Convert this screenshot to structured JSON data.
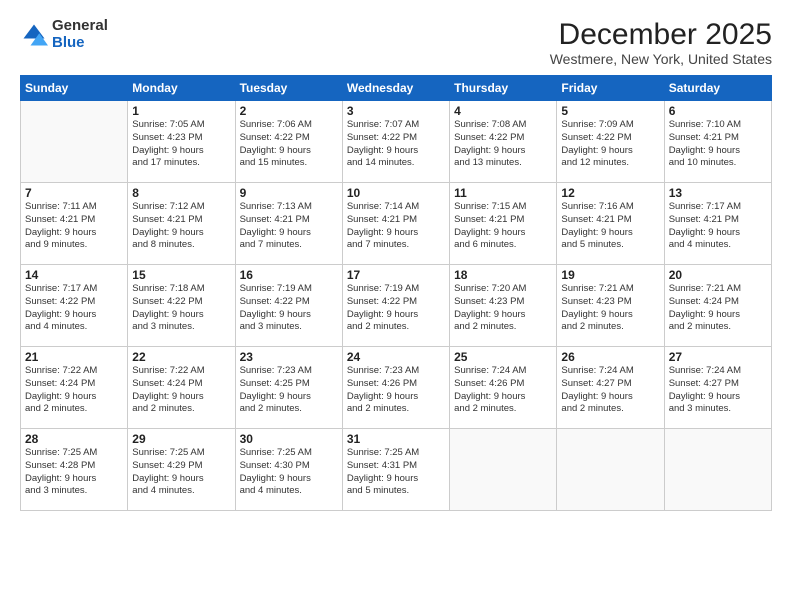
{
  "logo": {
    "general": "General",
    "blue": "Blue"
  },
  "title": "December 2025",
  "subtitle": "Westmere, New York, United States",
  "days_of_week": [
    "Sunday",
    "Monday",
    "Tuesday",
    "Wednesday",
    "Thursday",
    "Friday",
    "Saturday"
  ],
  "weeks": [
    [
      {
        "day": "",
        "info": ""
      },
      {
        "day": "1",
        "info": "Sunrise: 7:05 AM\nSunset: 4:23 PM\nDaylight: 9 hours\nand 17 minutes."
      },
      {
        "day": "2",
        "info": "Sunrise: 7:06 AM\nSunset: 4:22 PM\nDaylight: 9 hours\nand 15 minutes."
      },
      {
        "day": "3",
        "info": "Sunrise: 7:07 AM\nSunset: 4:22 PM\nDaylight: 9 hours\nand 14 minutes."
      },
      {
        "day": "4",
        "info": "Sunrise: 7:08 AM\nSunset: 4:22 PM\nDaylight: 9 hours\nand 13 minutes."
      },
      {
        "day": "5",
        "info": "Sunrise: 7:09 AM\nSunset: 4:22 PM\nDaylight: 9 hours\nand 12 minutes."
      },
      {
        "day": "6",
        "info": "Sunrise: 7:10 AM\nSunset: 4:21 PM\nDaylight: 9 hours\nand 10 minutes."
      }
    ],
    [
      {
        "day": "7",
        "info": "Sunrise: 7:11 AM\nSunset: 4:21 PM\nDaylight: 9 hours\nand 9 minutes."
      },
      {
        "day": "8",
        "info": "Sunrise: 7:12 AM\nSunset: 4:21 PM\nDaylight: 9 hours\nand 8 minutes."
      },
      {
        "day": "9",
        "info": "Sunrise: 7:13 AM\nSunset: 4:21 PM\nDaylight: 9 hours\nand 7 minutes."
      },
      {
        "day": "10",
        "info": "Sunrise: 7:14 AM\nSunset: 4:21 PM\nDaylight: 9 hours\nand 7 minutes."
      },
      {
        "day": "11",
        "info": "Sunrise: 7:15 AM\nSunset: 4:21 PM\nDaylight: 9 hours\nand 6 minutes."
      },
      {
        "day": "12",
        "info": "Sunrise: 7:16 AM\nSunset: 4:21 PM\nDaylight: 9 hours\nand 5 minutes."
      },
      {
        "day": "13",
        "info": "Sunrise: 7:17 AM\nSunset: 4:21 PM\nDaylight: 9 hours\nand 4 minutes."
      }
    ],
    [
      {
        "day": "14",
        "info": "Sunrise: 7:17 AM\nSunset: 4:22 PM\nDaylight: 9 hours\nand 4 minutes."
      },
      {
        "day": "15",
        "info": "Sunrise: 7:18 AM\nSunset: 4:22 PM\nDaylight: 9 hours\nand 3 minutes."
      },
      {
        "day": "16",
        "info": "Sunrise: 7:19 AM\nSunset: 4:22 PM\nDaylight: 9 hours\nand 3 minutes."
      },
      {
        "day": "17",
        "info": "Sunrise: 7:19 AM\nSunset: 4:22 PM\nDaylight: 9 hours\nand 2 minutes."
      },
      {
        "day": "18",
        "info": "Sunrise: 7:20 AM\nSunset: 4:23 PM\nDaylight: 9 hours\nand 2 minutes."
      },
      {
        "day": "19",
        "info": "Sunrise: 7:21 AM\nSunset: 4:23 PM\nDaylight: 9 hours\nand 2 minutes."
      },
      {
        "day": "20",
        "info": "Sunrise: 7:21 AM\nSunset: 4:24 PM\nDaylight: 9 hours\nand 2 minutes."
      }
    ],
    [
      {
        "day": "21",
        "info": "Sunrise: 7:22 AM\nSunset: 4:24 PM\nDaylight: 9 hours\nand 2 minutes."
      },
      {
        "day": "22",
        "info": "Sunrise: 7:22 AM\nSunset: 4:24 PM\nDaylight: 9 hours\nand 2 minutes."
      },
      {
        "day": "23",
        "info": "Sunrise: 7:23 AM\nSunset: 4:25 PM\nDaylight: 9 hours\nand 2 minutes."
      },
      {
        "day": "24",
        "info": "Sunrise: 7:23 AM\nSunset: 4:26 PM\nDaylight: 9 hours\nand 2 minutes."
      },
      {
        "day": "25",
        "info": "Sunrise: 7:24 AM\nSunset: 4:26 PM\nDaylight: 9 hours\nand 2 minutes."
      },
      {
        "day": "26",
        "info": "Sunrise: 7:24 AM\nSunset: 4:27 PM\nDaylight: 9 hours\nand 2 minutes."
      },
      {
        "day": "27",
        "info": "Sunrise: 7:24 AM\nSunset: 4:27 PM\nDaylight: 9 hours\nand 3 minutes."
      }
    ],
    [
      {
        "day": "28",
        "info": "Sunrise: 7:25 AM\nSunset: 4:28 PM\nDaylight: 9 hours\nand 3 minutes."
      },
      {
        "day": "29",
        "info": "Sunrise: 7:25 AM\nSunset: 4:29 PM\nDaylight: 9 hours\nand 4 minutes."
      },
      {
        "day": "30",
        "info": "Sunrise: 7:25 AM\nSunset: 4:30 PM\nDaylight: 9 hours\nand 4 minutes."
      },
      {
        "day": "31",
        "info": "Sunrise: 7:25 AM\nSunset: 4:31 PM\nDaylight: 9 hours\nand 5 minutes."
      },
      {
        "day": "",
        "info": ""
      },
      {
        "day": "",
        "info": ""
      },
      {
        "day": "",
        "info": ""
      }
    ]
  ]
}
